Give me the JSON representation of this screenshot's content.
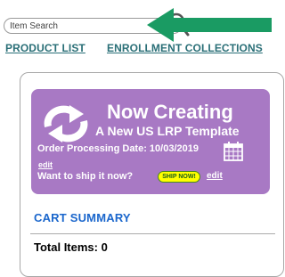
{
  "search": {
    "placeholder": "Item Search"
  },
  "nav": {
    "product_list": "PRODUCT LIST",
    "enrollment_collections": "ENROLLMENT COLLECTIONS"
  },
  "banner": {
    "title": "Now Creating",
    "subtitle": "A New US LRP Template",
    "order_processing": "Order Processing Date: 10/03/2019",
    "edit_date": "edit",
    "ship_prompt": "Want to ship it now?",
    "ship_button": "SHIP NOW!",
    "edit_ship": "edit"
  },
  "cart": {
    "heading": "CART SUMMARY",
    "total_items": "Total Items: 0"
  },
  "colors": {
    "accent_purple": "#a879c4",
    "arrow_green": "#1a9b63",
    "nav_teal": "#2a6f77",
    "cart_blue": "#1a66cc",
    "ship_button": "#ffff00"
  },
  "icons": {
    "search": "search-icon",
    "refresh": "refresh-icon",
    "calendar": "calendar-icon",
    "arrow": "arrow-icon"
  }
}
